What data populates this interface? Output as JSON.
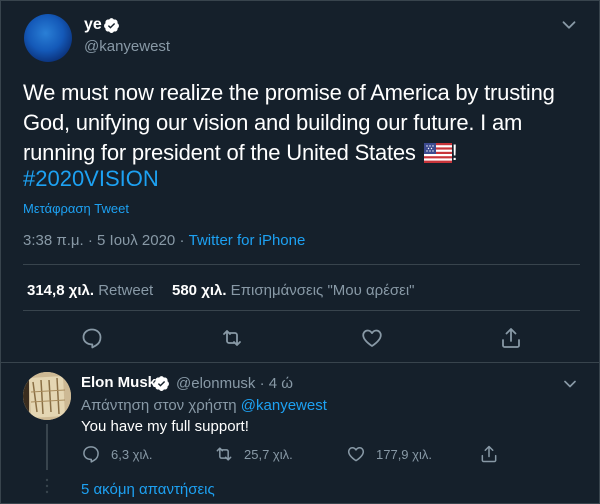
{
  "tweet": {
    "display_name": "ye",
    "handle": "@kanyewest",
    "text": "We must now realize the promise of America by trusting God, unifying our vision and building our future. I am running for president of the United States",
    "text_end": "!",
    "hashtag": "#2020VISION",
    "translate_label": "Μετάφραση Tweet",
    "timestamp": "3:38 π.μ. · 5 Ιουλ 2020 · ",
    "source": "Twitter for iPhone",
    "retweets_count": "314,8 χιλ.",
    "retweets_label": " Retweet",
    "likes_count": "580 χιλ.",
    "likes_label": " Επισημάνσεις \"Μου αρέσει\""
  },
  "reply": {
    "display_name": "Elon Musk",
    "handle_time": "@elonmusk · 4 ώ",
    "replying_prefix": "Απάντηση στον χρήστη ",
    "replying_mention": "@kanyewest",
    "text": "You have my full support!",
    "reply_count": "6,3 χιλ.",
    "retweet_count": "25,7 χιλ.",
    "like_count": "177,9 χιλ.",
    "more_replies": "5 ακόμη απαντήσεις"
  },
  "icons": {
    "verified": "verified-badge-icon",
    "more": "chevron-down-icon",
    "reply": "reply-icon",
    "retweet": "retweet-icon",
    "like": "heart-icon",
    "share": "share-icon",
    "flag": "us-flag-icon"
  },
  "colors": {
    "background": "#15202b",
    "accent": "#1da1f2",
    "secondary_text": "#8899a6",
    "divider": "#38444d"
  }
}
